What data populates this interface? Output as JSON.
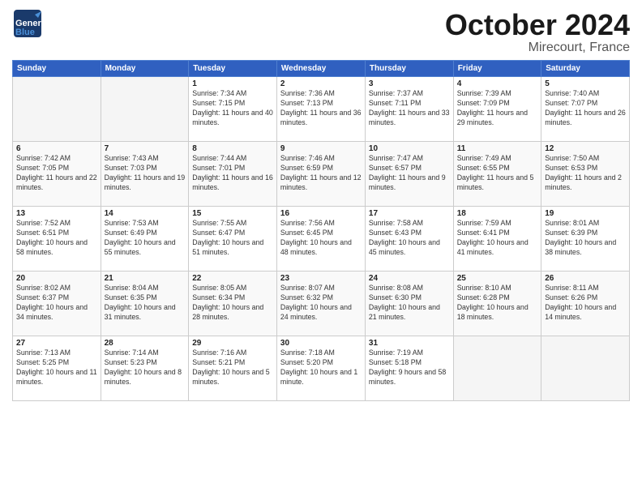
{
  "header": {
    "logo_line1": "General",
    "logo_line2": "Blue",
    "month": "October 2024",
    "location": "Mirecourt, France"
  },
  "weekdays": [
    "Sunday",
    "Monday",
    "Tuesday",
    "Wednesday",
    "Thursday",
    "Friday",
    "Saturday"
  ],
  "weeks": [
    [
      {
        "day": "",
        "detail": ""
      },
      {
        "day": "",
        "detail": ""
      },
      {
        "day": "1",
        "detail": "Sunrise: 7:34 AM\nSunset: 7:15 PM\nDaylight: 11 hours and 40 minutes."
      },
      {
        "day": "2",
        "detail": "Sunrise: 7:36 AM\nSunset: 7:13 PM\nDaylight: 11 hours and 36 minutes."
      },
      {
        "day": "3",
        "detail": "Sunrise: 7:37 AM\nSunset: 7:11 PM\nDaylight: 11 hours and 33 minutes."
      },
      {
        "day": "4",
        "detail": "Sunrise: 7:39 AM\nSunset: 7:09 PM\nDaylight: 11 hours and 29 minutes."
      },
      {
        "day": "5",
        "detail": "Sunrise: 7:40 AM\nSunset: 7:07 PM\nDaylight: 11 hours and 26 minutes."
      }
    ],
    [
      {
        "day": "6",
        "detail": "Sunrise: 7:42 AM\nSunset: 7:05 PM\nDaylight: 11 hours and 22 minutes."
      },
      {
        "day": "7",
        "detail": "Sunrise: 7:43 AM\nSunset: 7:03 PM\nDaylight: 11 hours and 19 minutes."
      },
      {
        "day": "8",
        "detail": "Sunrise: 7:44 AM\nSunset: 7:01 PM\nDaylight: 11 hours and 16 minutes."
      },
      {
        "day": "9",
        "detail": "Sunrise: 7:46 AM\nSunset: 6:59 PM\nDaylight: 11 hours and 12 minutes."
      },
      {
        "day": "10",
        "detail": "Sunrise: 7:47 AM\nSunset: 6:57 PM\nDaylight: 11 hours and 9 minutes."
      },
      {
        "day": "11",
        "detail": "Sunrise: 7:49 AM\nSunset: 6:55 PM\nDaylight: 11 hours and 5 minutes."
      },
      {
        "day": "12",
        "detail": "Sunrise: 7:50 AM\nSunset: 6:53 PM\nDaylight: 11 hours and 2 minutes."
      }
    ],
    [
      {
        "day": "13",
        "detail": "Sunrise: 7:52 AM\nSunset: 6:51 PM\nDaylight: 10 hours and 58 minutes."
      },
      {
        "day": "14",
        "detail": "Sunrise: 7:53 AM\nSunset: 6:49 PM\nDaylight: 10 hours and 55 minutes."
      },
      {
        "day": "15",
        "detail": "Sunrise: 7:55 AM\nSunset: 6:47 PM\nDaylight: 10 hours and 51 minutes."
      },
      {
        "day": "16",
        "detail": "Sunrise: 7:56 AM\nSunset: 6:45 PM\nDaylight: 10 hours and 48 minutes."
      },
      {
        "day": "17",
        "detail": "Sunrise: 7:58 AM\nSunset: 6:43 PM\nDaylight: 10 hours and 45 minutes."
      },
      {
        "day": "18",
        "detail": "Sunrise: 7:59 AM\nSunset: 6:41 PM\nDaylight: 10 hours and 41 minutes."
      },
      {
        "day": "19",
        "detail": "Sunrise: 8:01 AM\nSunset: 6:39 PM\nDaylight: 10 hours and 38 minutes."
      }
    ],
    [
      {
        "day": "20",
        "detail": "Sunrise: 8:02 AM\nSunset: 6:37 PM\nDaylight: 10 hours and 34 minutes."
      },
      {
        "day": "21",
        "detail": "Sunrise: 8:04 AM\nSunset: 6:35 PM\nDaylight: 10 hours and 31 minutes."
      },
      {
        "day": "22",
        "detail": "Sunrise: 8:05 AM\nSunset: 6:34 PM\nDaylight: 10 hours and 28 minutes."
      },
      {
        "day": "23",
        "detail": "Sunrise: 8:07 AM\nSunset: 6:32 PM\nDaylight: 10 hours and 24 minutes."
      },
      {
        "day": "24",
        "detail": "Sunrise: 8:08 AM\nSunset: 6:30 PM\nDaylight: 10 hours and 21 minutes."
      },
      {
        "day": "25",
        "detail": "Sunrise: 8:10 AM\nSunset: 6:28 PM\nDaylight: 10 hours and 18 minutes."
      },
      {
        "day": "26",
        "detail": "Sunrise: 8:11 AM\nSunset: 6:26 PM\nDaylight: 10 hours and 14 minutes."
      }
    ],
    [
      {
        "day": "27",
        "detail": "Sunrise: 7:13 AM\nSunset: 5:25 PM\nDaylight: 10 hours and 11 minutes."
      },
      {
        "day": "28",
        "detail": "Sunrise: 7:14 AM\nSunset: 5:23 PM\nDaylight: 10 hours and 8 minutes."
      },
      {
        "day": "29",
        "detail": "Sunrise: 7:16 AM\nSunset: 5:21 PM\nDaylight: 10 hours and 5 minutes."
      },
      {
        "day": "30",
        "detail": "Sunrise: 7:18 AM\nSunset: 5:20 PM\nDaylight: 10 hours and 1 minute."
      },
      {
        "day": "31",
        "detail": "Sunrise: 7:19 AM\nSunset: 5:18 PM\nDaylight: 9 hours and 58 minutes."
      },
      {
        "day": "",
        "detail": ""
      },
      {
        "day": "",
        "detail": ""
      }
    ]
  ]
}
